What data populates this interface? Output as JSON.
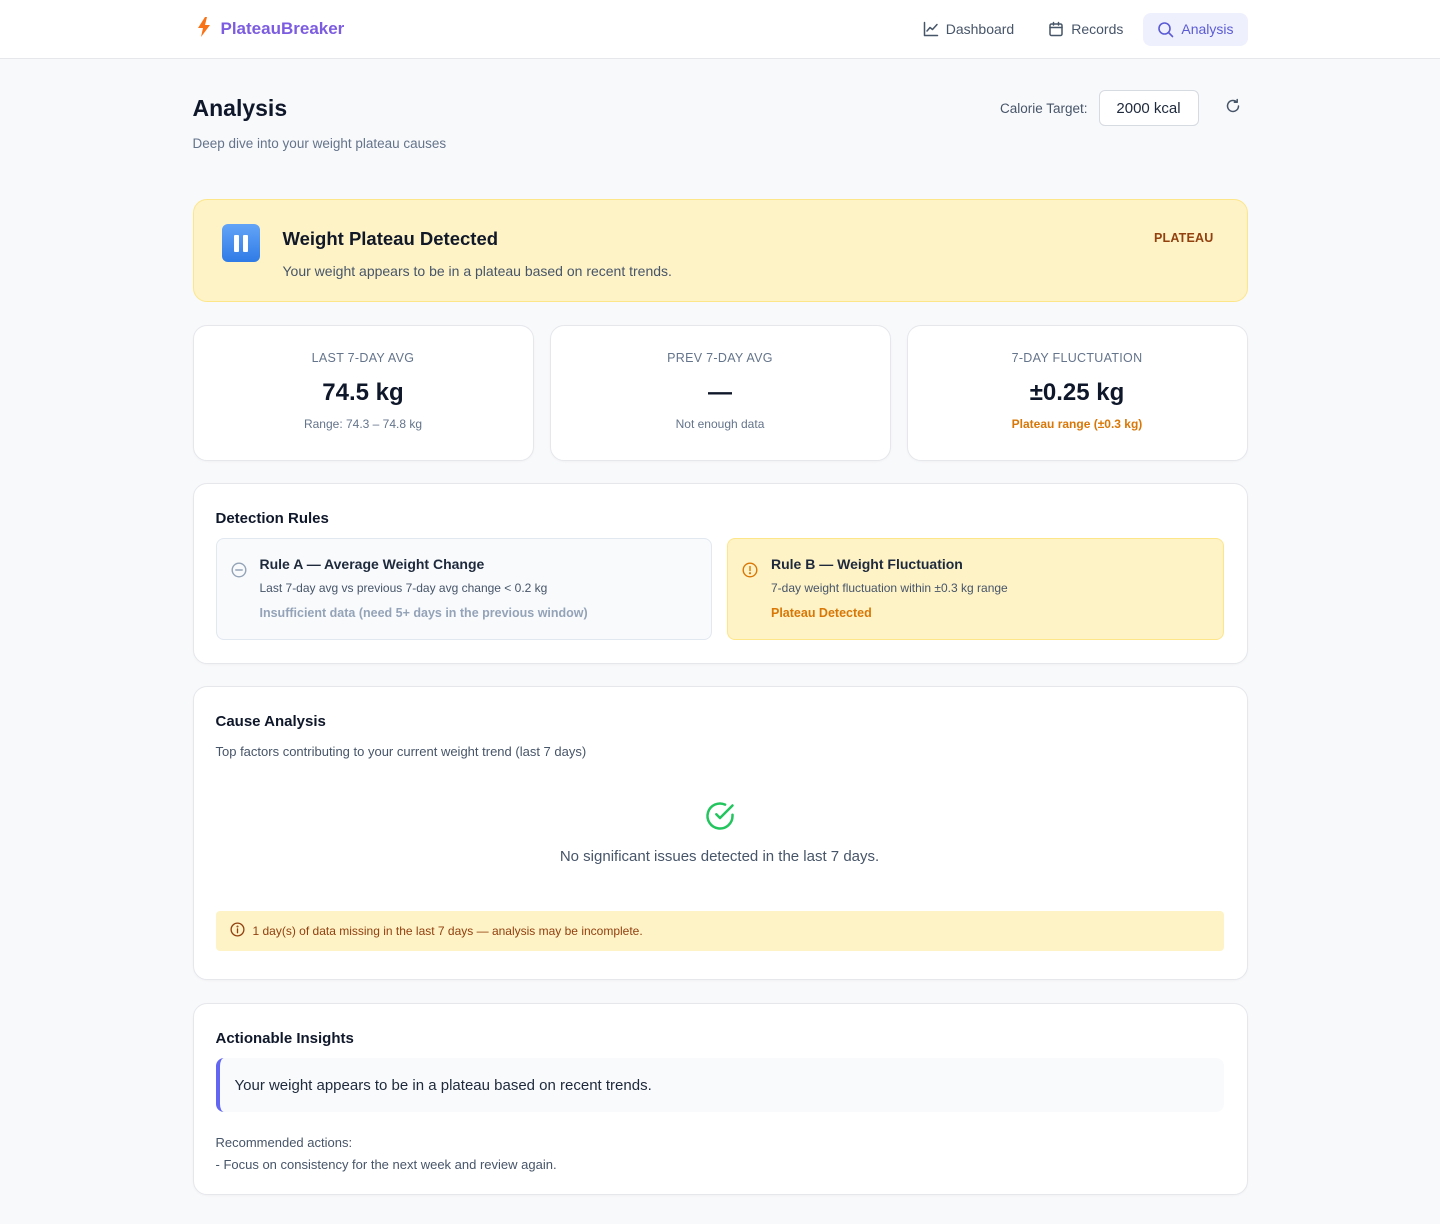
{
  "brand": {
    "name": "PlateauBreaker",
    "accent": "#7c5ce0",
    "icon": "bolt-icon"
  },
  "nav": {
    "items": [
      {
        "label": "Dashboard",
        "icon": "chart-line-icon",
        "active": false
      },
      {
        "label": "Records",
        "icon": "calendar-icon",
        "active": false
      },
      {
        "label": "Analysis",
        "icon": "search-icon",
        "active": true
      }
    ]
  },
  "page": {
    "title": "Analysis",
    "subtitle": "Deep dive into your weight plateau causes",
    "calorie_label": "Calorie Target:",
    "calorie_value": "2000 kcal"
  },
  "banner": {
    "title": "Weight Plateau Detected",
    "description": "Your weight appears to be in a plateau based on recent trends.",
    "badge": "PLATEAU",
    "icon": "pause-icon"
  },
  "stats": [
    {
      "label": "LAST 7-DAY AVG",
      "value": "74.5 kg",
      "note": "Range: 74.3 – 74.8 kg"
    },
    {
      "label": "PREV 7-DAY AVG",
      "value": "—",
      "note": "Not enough data"
    },
    {
      "label": "7-DAY FLUCTUATION",
      "value": "±0.25 kg",
      "note": "Plateau range (±0.3 kg)"
    }
  ],
  "rules": {
    "title": "Detection Rules",
    "items": [
      {
        "title": "Rule A — Average Weight Change",
        "description": "Last 7-day avg vs previous 7-day avg change < 0.2 kg",
        "status": "Insufficient data (need 5+ days in the previous window)",
        "icon": "minus-circle-icon"
      },
      {
        "title": "Rule B — Weight Fluctuation",
        "description": "7-day weight fluctuation within ±0.3 kg range",
        "status": "Plateau Detected",
        "icon": "alert-circle-icon"
      }
    ]
  },
  "cause": {
    "title": "Cause Analysis",
    "subtitle": "Top factors contributing to your current weight trend (last 7 days)",
    "empty_text": "No significant issues detected in the last 7 days.",
    "warning": "1 day(s) of data missing in the last 7 days — analysis may be incomplete."
  },
  "insights": {
    "title": "Actionable Insights",
    "message": "Your weight appears to be in a plateau based on recent trends.",
    "actions_heading": "Recommended actions:",
    "actions": [
      "- Focus on consistency for the next week and review again."
    ]
  },
  "colors": {
    "warning_bg": "#fef3c7",
    "warning_text": "#d97706",
    "insight_accent": "#6366f1",
    "success": "#22c55e"
  }
}
